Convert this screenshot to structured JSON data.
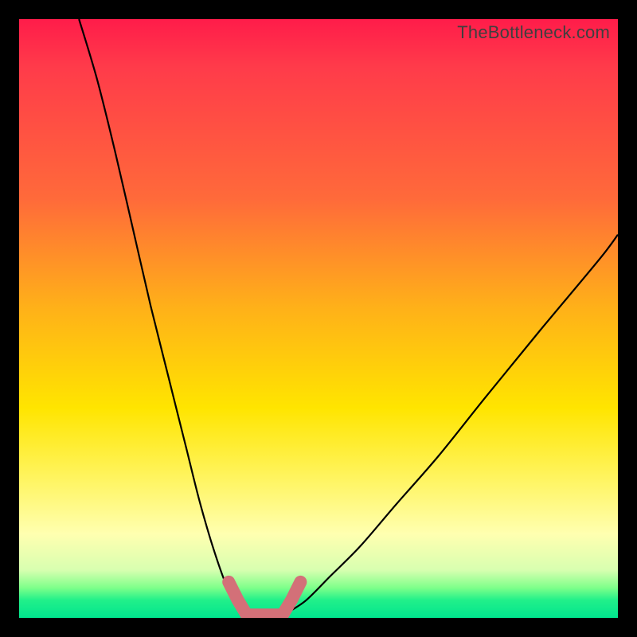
{
  "watermark": "TheBottleneck.com",
  "colors": {
    "frame": "#000000",
    "gradient_top": "#ff1c4a",
    "gradient_mid": "#ffe500",
    "gradient_bottom": "#00e58e",
    "curve": "#000000",
    "bottom_mark": "#d37078"
  },
  "chart_data": {
    "type": "line",
    "title": "",
    "xlabel": "",
    "ylabel": "",
    "xlim": [
      0,
      100
    ],
    "ylim": [
      0,
      100
    ],
    "series": [
      {
        "name": "left-curve",
        "x": [
          10,
          13,
          16,
          19,
          22,
          25,
          28,
          30,
          32,
          34,
          35.5,
          37
        ],
        "y": [
          100,
          90,
          78,
          65,
          52,
          40,
          28,
          20,
          13,
          7,
          3.5,
          1
        ]
      },
      {
        "name": "right-curve",
        "x": [
          45,
          48,
          52,
          57,
          63,
          70,
          78,
          87,
          97,
          100
        ],
        "y": [
          1,
          3,
          7,
          12,
          19,
          27,
          37,
          48,
          60,
          64
        ]
      },
      {
        "name": "bottom-U-mark",
        "x": [
          35,
          36.5,
          38,
          44,
          45.5,
          47
        ],
        "y": [
          6,
          3,
          0.5,
          0.5,
          3,
          6
        ]
      }
    ]
  }
}
